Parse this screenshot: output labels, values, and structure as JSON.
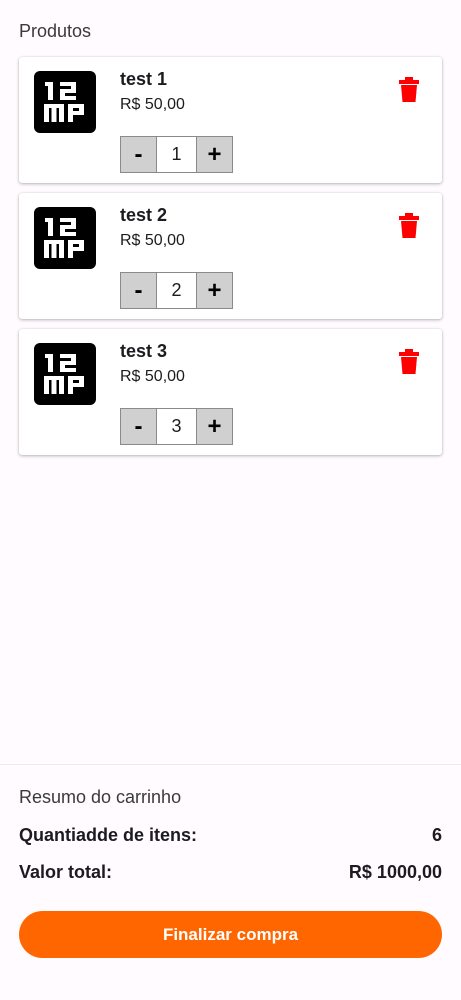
{
  "products_section": {
    "title": "Produtos"
  },
  "products": [
    {
      "name": "test 1",
      "price": "R$ 50,00",
      "quantity": "1",
      "minus_label": "-",
      "plus_label": "+",
      "image_icon": "12mp-logo-icon",
      "delete_icon": "trash-icon"
    },
    {
      "name": "test 2",
      "price": "R$ 50,00",
      "quantity": "2",
      "minus_label": "-",
      "plus_label": "+",
      "image_icon": "12mp-logo-icon",
      "delete_icon": "trash-icon"
    },
    {
      "name": "test 3",
      "price": "R$ 50,00",
      "quantity": "3",
      "minus_label": "-",
      "plus_label": "+",
      "image_icon": "12mp-logo-icon",
      "delete_icon": "trash-icon"
    }
  ],
  "summary": {
    "title": "Resumo do carrinho",
    "items_label": "Quantiadde de itens:",
    "items_value": "6",
    "total_label": "Valor total:",
    "total_value": "R$ 1000,00",
    "checkout_label": "Finalizar compra"
  },
  "colors": {
    "accent": "#ff6600",
    "delete": "#ff0000",
    "background": "#fffbfe"
  }
}
